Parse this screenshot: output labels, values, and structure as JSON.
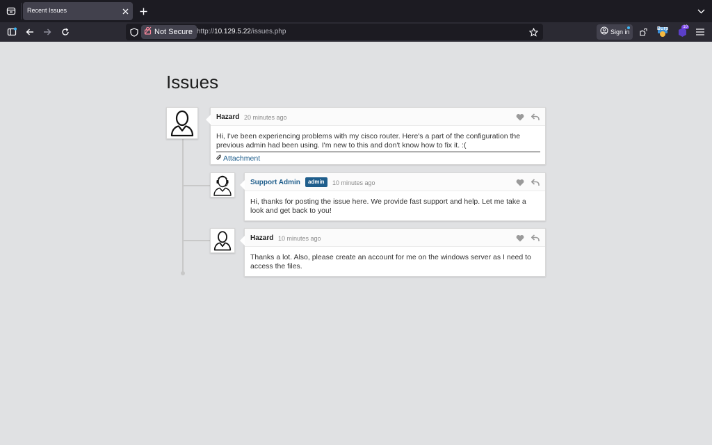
{
  "browser": {
    "tab_title": "Recent Issues",
    "security_label": "Not Secure",
    "url_prefix": "http://",
    "url_host": "10.129.5.22",
    "url_path": "/issues.php",
    "signin_label": "Sign in",
    "ext_badge": "Burp",
    "ext_count": "10"
  },
  "page": {
    "title": "Issues"
  },
  "comments": [
    {
      "author": "Hazard",
      "time": "20 minutes ago",
      "body": "Hi, I've been experiencing problems with my cisco router. Here's a part of the configuration the previous admin had been using. I'm new to this and don't know how to fix it. :(",
      "attachment": "Attachment"
    },
    {
      "author": "Support Admin",
      "badge": "admin",
      "time": "10 minutes ago",
      "body": "Hi, thanks for posting the issue here. We provide fast support and help. Let me take a look and get back to you!"
    },
    {
      "author": "Hazard",
      "time": "10 minutes ago",
      "body": "Thanks a lot. Also, please create an account for me on the windows server as I need to access the files."
    }
  ],
  "colors": {
    "accent": "#1f5e8c",
    "page_bg": "#e0e1e3",
    "chrome_bg": "#2b2a33"
  }
}
